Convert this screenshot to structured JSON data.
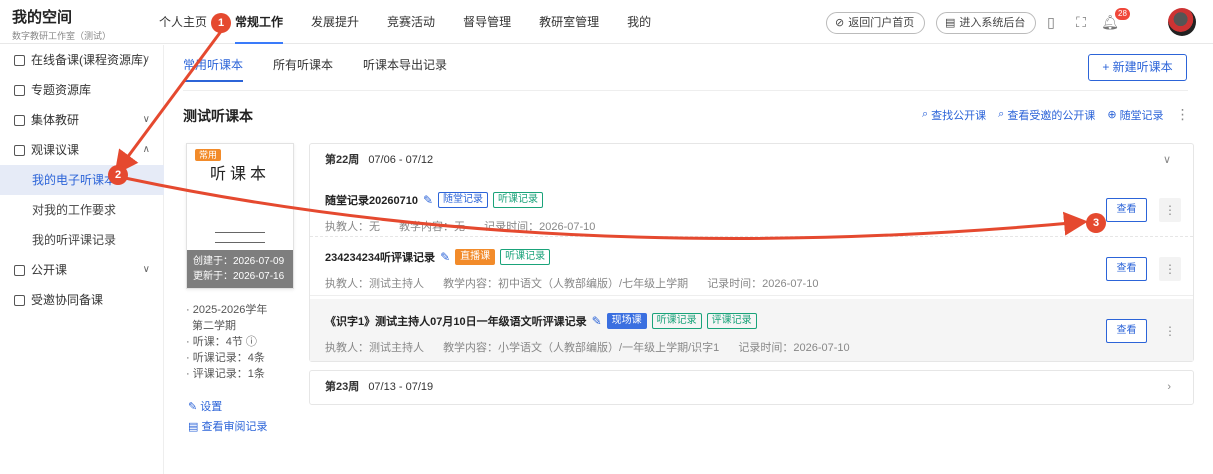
{
  "brand": {
    "title": "我的空间",
    "subtitle": "数字教研工作室（测试）"
  },
  "topnav": [
    "个人主页",
    "常规工作",
    "发展提升",
    "竞赛活动",
    "督导管理",
    "教研室管理",
    "我的"
  ],
  "header": {
    "portal_btn": "返回门户首页",
    "backend_btn": "进入系统后台",
    "notify_count": "28"
  },
  "sidebar": {
    "items": [
      {
        "label": "在线备课(课程资源库)"
      },
      {
        "label": "专题资源库"
      },
      {
        "label": "集体教研"
      },
      {
        "label": "观课议课"
      },
      {
        "label": "公开课"
      },
      {
        "label": "受邀协同备课"
      }
    ],
    "sub": [
      "我的电子听课本",
      "对我的工作要求",
      "我的听评课记录"
    ]
  },
  "tabs": [
    "常用听课本",
    "所有听课本",
    "听课本导出记录"
  ],
  "new_button": "+ 新建听课本",
  "page_title": "测试听课本",
  "actions": {
    "find": "查找公开课",
    "invited": "查看受邀的公开课",
    "record": "随堂记录"
  },
  "book": {
    "tag": "常用",
    "title": "听课本",
    "created": "创建于：2026-07-09",
    "updated": "更新于：2026-07-16",
    "info": [
      "· 2025-2026学年",
      "  第二学期",
      "· 听课：4节 ⓘ",
      "· 听课记录：4条",
      "· 评课记录：1条"
    ],
    "settings": "设置",
    "review": "查看审阅记录"
  },
  "weeks": [
    {
      "label": "第22周",
      "range": "07/06 - 07/12",
      "records": [
        {
          "title": "随堂记录20260710",
          "chips": [
            "随堂记录",
            "听课记录"
          ],
          "teacher": "执教人：无",
          "content": "教学内容：无",
          "time": "记录时间：2026-07-10",
          "view": "查看"
        },
        {
          "title": "234234234听评课记录",
          "chips": [
            "直播课",
            "听课记录"
          ],
          "teacher": "执教人：测试主持人",
          "content": "教学内容：初中语文（人教部编版）/七年级上学期",
          "time": "记录时间：2026-07-10",
          "view": "查看"
        },
        {
          "title": "《识字1》测试主持人07月10日一年级语文听评课记录",
          "chips": [
            "现场课",
            "听课记录",
            "评课记录"
          ],
          "teacher": "执教人：测试主持人",
          "content": "教学内容：小学语文（人教部编版）/一年级上学期/识字1",
          "time": "记录时间：2026-07-10",
          "view": "查看"
        }
      ]
    },
    {
      "label": "第23周",
      "range": "07/13 - 07/19",
      "records": []
    }
  ],
  "annotations": [
    "1",
    "2",
    "3"
  ],
  "colors": {
    "accent": "#2c64d8",
    "annotation": "#e5492f",
    "tag_orange": "#f28b2a",
    "chip_green": "#1aa37a"
  }
}
